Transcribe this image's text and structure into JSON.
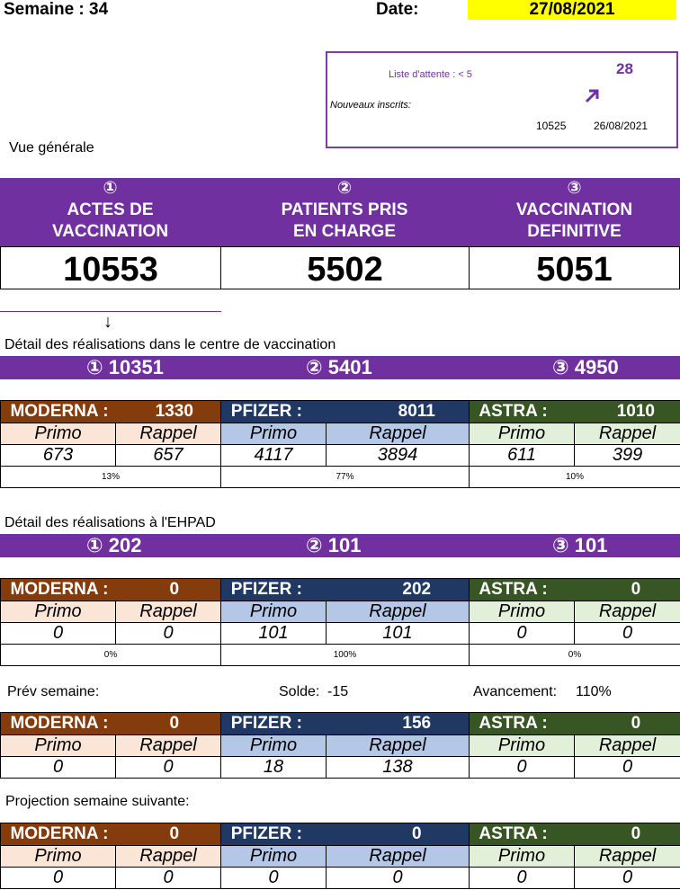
{
  "header": {
    "week_label": "Semaine : 34",
    "date_label": "Date:",
    "date_value": "27/08/2021",
    "date_highlight": "#ffff00"
  },
  "waitlist": {
    "title": "Liste d'attente : < 5",
    "new_registrants_label": "Nouveaux inscrits:",
    "delta": "28",
    "trend_icon": "arrow-up-right-icon",
    "total": "10525",
    "total_date": "26/08/2021"
  },
  "overview": {
    "title": "Vue générale",
    "kpis": [
      {
        "symbol": "①",
        "line1": "ACTES DE",
        "line2": "VACCINATION",
        "value": "10553"
      },
      {
        "symbol": "②",
        "line1": "PATIENTS PRIS",
        "line2": "EN CHARGE",
        "value": "5502"
      },
      {
        "symbol": "③",
        "line1": "VACCINATION",
        "line2": "DEFINITIVE",
        "value": "5051"
      }
    ],
    "down_arrow": "↓"
  },
  "center": {
    "title": "Détail des réalisations dans le centre de vaccination",
    "band": [
      "①  10351",
      "② 5401",
      "③ 4950"
    ],
    "table": {
      "moderna": {
        "label": "MODERNA :",
        "total": "1330",
        "primo_label": "Primo",
        "rappel_label": "Rappel",
        "primo": "673",
        "rappel": "657",
        "pct": "13%"
      },
      "pfizer": {
        "label": "PFIZER :",
        "total": "8011",
        "primo_label": "Primo",
        "rappel_label": "Rappel",
        "primo": "4117",
        "rappel": "3894",
        "pct": "77%"
      },
      "astra": {
        "label": "ASTRA :",
        "total": "1010",
        "primo_label": "Primo",
        "rappel_label": "Rappel",
        "primo": "611",
        "rappel": "399",
        "pct": "10%"
      }
    }
  },
  "ehpad": {
    "title": "Détail des réalisations à l'EHPAD",
    "band": [
      "①  202",
      "② 101",
      "③ 101"
    ],
    "table": {
      "moderna": {
        "label": "MODERNA :",
        "total": "0",
        "primo_label": "Primo",
        "rappel_label": "Rappel",
        "primo": "0",
        "rappel": "0",
        "pct": "0%"
      },
      "pfizer": {
        "label": "PFIZER :",
        "total": "202",
        "primo_label": "Primo",
        "rappel_label": "Rappel",
        "primo": "101",
        "rappel": "101",
        "pct": "100%"
      },
      "astra": {
        "label": "ASTRA :",
        "total": "0",
        "primo_label": "Primo",
        "rappel_label": "Rappel",
        "primo": "0",
        "rappel": "0",
        "pct": "0%"
      }
    }
  },
  "forecast": {
    "label": "Prév semaine:",
    "solde_label": "Solde:",
    "solde_value": "-15",
    "progress_label": "Avancement:",
    "progress_value": "110%",
    "table": {
      "moderna": {
        "label": "MODERNA :",
        "total": "0",
        "primo_label": "Primo",
        "rappel_label": "Rappel",
        "primo": "0",
        "rappel": "0"
      },
      "pfizer": {
        "label": "PFIZER :",
        "total": "156",
        "primo_label": "Primo",
        "rappel_label": "Rappel",
        "primo": "18",
        "rappel": "138"
      },
      "astra": {
        "label": "ASTRA :",
        "total": "0",
        "primo_label": "Primo",
        "rappel_label": "Rappel",
        "primo": "0",
        "rappel": "0"
      }
    }
  },
  "projection": {
    "label": "Projection semaine suivante:",
    "table": {
      "moderna": {
        "label": "MODERNA :",
        "total": "0",
        "primo_label": "Primo",
        "rappel_label": "Rappel",
        "primo": "0",
        "rappel": "0"
      },
      "pfizer": {
        "label": "PFIZER :",
        "total": "0",
        "primo_label": "Primo",
        "rappel_label": "Rappel",
        "primo": "0",
        "rappel": "0"
      },
      "astra": {
        "label": "ASTRA :",
        "total": "0",
        "primo_label": "Primo",
        "rappel_label": "Rappel",
        "primo": "0",
        "rappel": "0"
      }
    }
  },
  "colors": {
    "purple": "#7030a0",
    "moderna": "#843c0c",
    "pfizer": "#203864",
    "astra": "#375623"
  }
}
